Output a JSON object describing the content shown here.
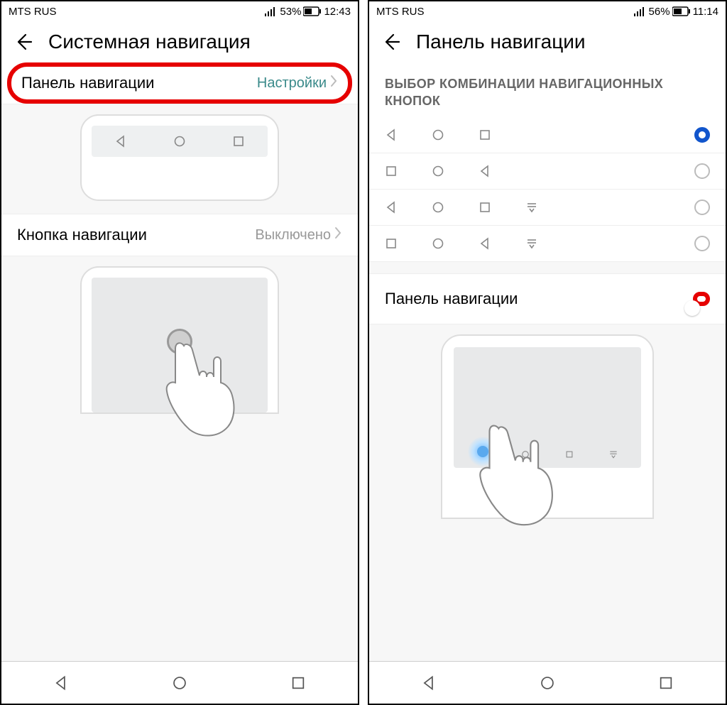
{
  "left": {
    "status": {
      "carrier": "MTS RUS",
      "battery": "53%",
      "time": "12:43"
    },
    "title": "Системная навигация",
    "row1": {
      "label": "Панель навигации",
      "value": "Настройки"
    },
    "row2": {
      "label": "Кнопка навигации",
      "value": "Выключено"
    }
  },
  "right": {
    "status": {
      "carrier": "MTS RUS",
      "battery": "56%",
      "time": "11:14"
    },
    "title": "Панель навигации",
    "section_header": "ВЫБОР КОМБИНАЦИИ НАВИГАЦИОННЫХ КНОПОК",
    "options": [
      {
        "keys": [
          "back",
          "home",
          "recent"
        ],
        "selected": true
      },
      {
        "keys": [
          "recent",
          "home",
          "back"
        ],
        "selected": false
      },
      {
        "keys": [
          "back",
          "home",
          "recent",
          "notif"
        ],
        "selected": false
      },
      {
        "keys": [
          "recent",
          "home",
          "back",
          "notif"
        ],
        "selected": false
      }
    ],
    "toggle": {
      "label": "Панель навигации",
      "on": true
    }
  },
  "icons": {
    "back": "triangle-left",
    "home": "circle",
    "recent": "square",
    "notif": "pulldown"
  }
}
